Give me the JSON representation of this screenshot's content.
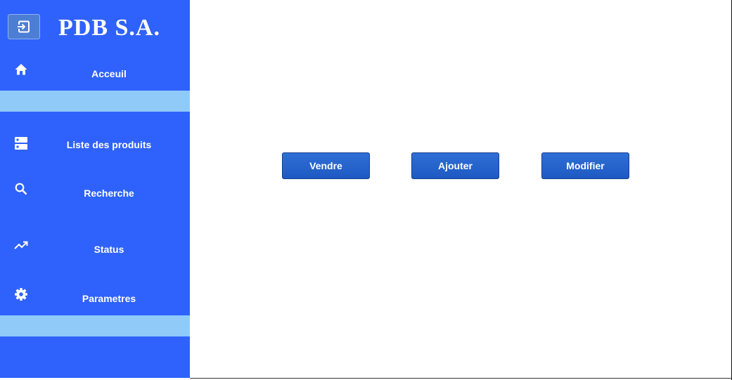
{
  "sidebar": {
    "brand": "PDB S.A.",
    "exit_icon": "exit-to-app-icon",
    "items": [
      {
        "label": "Acceuil",
        "icon": "home-icon"
      },
      {
        "label": "Liste des produits",
        "icon": "list-icon"
      },
      {
        "label": "Recherche",
        "icon": "search-icon"
      },
      {
        "label": "Status",
        "icon": "trending-up-icon"
      },
      {
        "label": "Parametres",
        "icon": "gear-icon"
      }
    ],
    "band_color": "#90caf9",
    "background_color": "#2f62fc"
  },
  "main": {
    "buttons": [
      {
        "label": "Vendre"
      },
      {
        "label": "Ajouter"
      },
      {
        "label": "Modifier"
      }
    ],
    "button_color": "#1e59c2"
  }
}
